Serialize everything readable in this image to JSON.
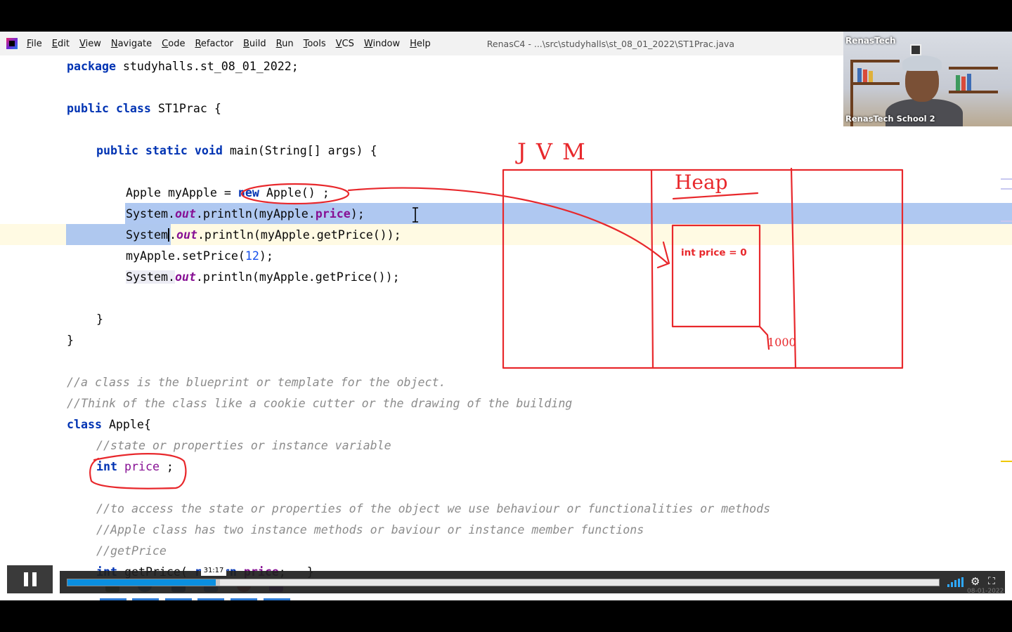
{
  "menu": {
    "items": [
      "File",
      "Edit",
      "View",
      "Navigate",
      "Code",
      "Refactor",
      "Build",
      "Run",
      "Tools",
      "VCS",
      "Window",
      "Help"
    ],
    "window_title": "RenasC4 - ...\\src\\studyhalls\\st_08_01_2022\\ST1Prac.java"
  },
  "code": {
    "package_kw": "package",
    "package_name": " studyhalls.st_08_01_2022;",
    "public_kw": "public",
    "class_kw": "class",
    "class_name": " ST1Prac {",
    "main_mods": "public static void",
    "main_sig": " main(String[] args) {",
    "l5_a": "Apple myApple = ",
    "l5_new": "new",
    "l5_b": " Apple() ;",
    "l6_a": "System.",
    "l6_out": "out",
    "l6_b": ".println(myApple.",
    "l6_price": "price",
    "l6_c": ");",
    "l7_a": "System",
    "l7_b": ".",
    "l7_out": "out",
    "l7_c": ".println(myApple.getPrice());",
    "l8_a": "myApple.setPrice(",
    "l8_num": "12",
    "l8_b": ");",
    "l9_a": "System.",
    "l9_out": "out",
    "l9_b": ".println(myApple.getPrice());",
    "close_inner": "}",
    "close_outer": "}",
    "comment1": "//a class is the blueprint or template for the object.",
    "comment2": "//Think of the class like a cookie cutter or the drawing of the building",
    "apple_class_kw": "class",
    "apple_class_name": " Apple{",
    "comment3": "//state or properties or instance variable",
    "field_type": "int",
    "field_name": "price",
    "field_end": " ;",
    "comment4": "//to access the state or properties of the object we use behaviour or functionalities or methods",
    "comment5": "//Apple class has two instance methods or baviour or instance member functions",
    "comment6": "//getPrice",
    "getter_kw": "int",
    "getter_a": " getPrice( ",
    "getter_ret": "return",
    "getter_price": "price",
    "getter_b": ";   }"
  },
  "annotation": {
    "jvm_label": "JVM",
    "heap_label": "Heap",
    "object_text": "int price = 0",
    "address_label": "1000",
    "color": "#e8282c"
  },
  "webcam": {
    "brand": "RenasTech",
    "participant": "RenasTech School 2"
  },
  "player": {
    "hover_time": "31:17",
    "progress_played": 0.17,
    "progress_buffered": 0.175,
    "date": "08-01-2022",
    "accent": "#0a8fe0"
  }
}
